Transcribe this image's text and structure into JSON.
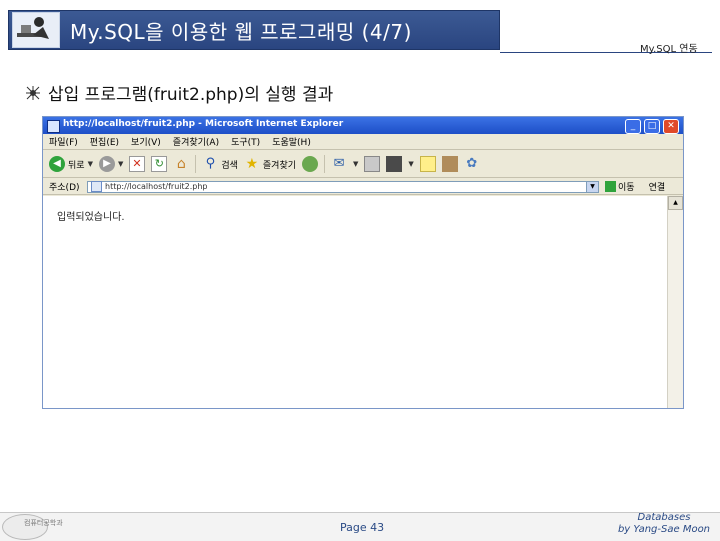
{
  "slide": {
    "title": "My.SQL을 이용한 웹 프로그래밍 (4/7)",
    "section_label": "My.SQL 연동",
    "bullet_text": "삽입 프로그램(fruit2.php)의 실행 결과"
  },
  "browser": {
    "window_title": "http://localhost/fruit2.php - Microsoft Internet Explorer",
    "menu": [
      "파일(F)",
      "편집(E)",
      "보기(V)",
      "즐겨찾기(A)",
      "도구(T)",
      "도움말(H)"
    ],
    "toolbar": {
      "back_label": "뒤로",
      "search_label": "검색",
      "favorites_label": "즐겨찾기"
    },
    "address": {
      "label": "주소(D)",
      "value": "http://localhost/fruit2.php",
      "go_label": "이동",
      "links_label": "연결"
    },
    "content_text": "입력되었습니다."
  },
  "footer": {
    "university": "컴퓨터공학과",
    "page": "Page 43",
    "credit_line1": "Databases",
    "credit_line2": "by Yang-Sae Moon"
  }
}
